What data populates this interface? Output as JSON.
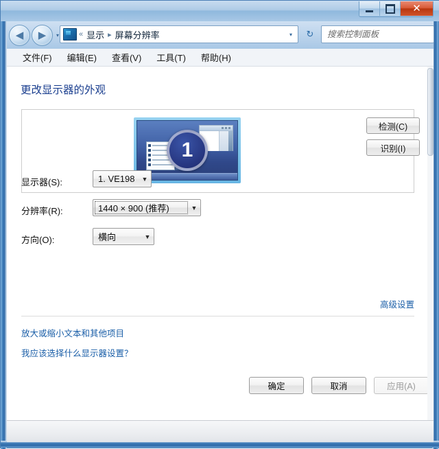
{
  "window": {
    "controls": {
      "minimize_label": "–",
      "maximize_label": "□",
      "close_label": "✕"
    }
  },
  "navbar": {
    "back_label": "◀",
    "forward_label": "▶",
    "history_dropdown_label": "▾",
    "breadcrumb": {
      "prefix": "«",
      "items": [
        "显示",
        "屏幕分辨率"
      ],
      "separator": "▸"
    },
    "address_dropdown_label": "▾",
    "refresh_label": "↻",
    "search": {
      "placeholder": "搜索控制面板",
      "value": "",
      "icon_label": "⚲"
    }
  },
  "menubar": {
    "items": [
      {
        "label": "文件(F)"
      },
      {
        "label": "编辑(E)"
      },
      {
        "label": "查看(V)"
      },
      {
        "label": "工具(T)"
      },
      {
        "label": "帮助(H)"
      }
    ]
  },
  "main": {
    "heading": "更改显示器的外观",
    "preview": {
      "monitor_number": "1"
    },
    "side_buttons": {
      "detect": "检测(C)",
      "identify": "识别(I)"
    },
    "fields": {
      "monitor": {
        "label": "显示器(S):",
        "value": "1. VE198",
        "arrow": "▼"
      },
      "resolution": {
        "label": "分辨率(R):",
        "value": "1440 × 900 (推荐)",
        "arrow": "▼"
      },
      "orientation": {
        "label": "方向(O):",
        "value": "横向",
        "arrow": "▼"
      }
    },
    "links": {
      "advanced": "高级设置",
      "scale_text": "放大或缩小文本和其他项目",
      "which_settings": "我应该选择什么显示器设置？"
    },
    "dialog_buttons": {
      "ok": "确定",
      "cancel": "取消",
      "apply": "应用(A)",
      "apply_disabled": true
    }
  }
}
